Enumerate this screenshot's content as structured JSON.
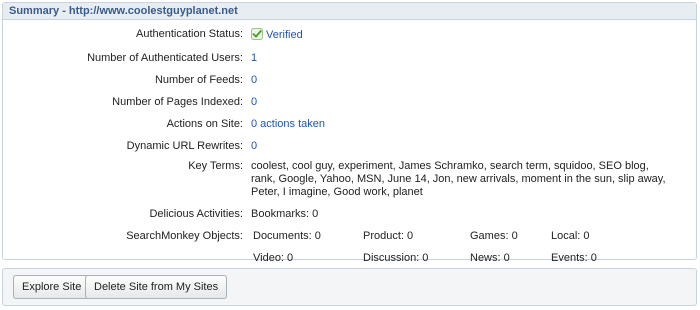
{
  "panel": {
    "title": "Summary - http://www.coolestguyplanet.net"
  },
  "summary": {
    "auth_status_label": "Authentication Status:",
    "auth_status_value": "Verified",
    "auth_status_icon": "check-icon",
    "auth_users_label": "Number of Authenticated Users:",
    "auth_users_value": "1",
    "feeds_label": "Number of Feeds:",
    "feeds_value": "0",
    "pages_label": "Number of Pages Indexed:",
    "pages_value": "0",
    "actions_label": "Actions on Site:",
    "actions_value": "0 actions taken",
    "rewrites_label": "Dynamic URL Rewrites:",
    "rewrites_value": "0",
    "key_terms_label": "Key Terms:",
    "key_terms_value": "coolest, cool guy, experiment, James Schramko, search term, squidoo, SEO blog, rank, Google, Yahoo, MSN, June 14, Jon, new arrivals, moment in the sun, slip away, Peter, I imagine, Good work, planet",
    "delicious_label": "Delicious Activities:",
    "delicious_value": "Bookmarks: 0",
    "searchmonkey_label": "SearchMonkey Objects:",
    "searchmonkey": {
      "documents": "Documents: 0",
      "product": "Product: 0",
      "games": "Games: 0",
      "local": "Local: 0",
      "video": "Video: 0",
      "discussion": "Discussion: 0",
      "news": "News: 0",
      "events": "Events: 0"
    }
  },
  "footer": {
    "explore_label": "Explore Site",
    "delete_label": "Delete Site from My Sites"
  },
  "colors": {
    "link": "#1e56b0",
    "header_text": "#3a5c88",
    "verified_green": "#4a9a2a"
  }
}
